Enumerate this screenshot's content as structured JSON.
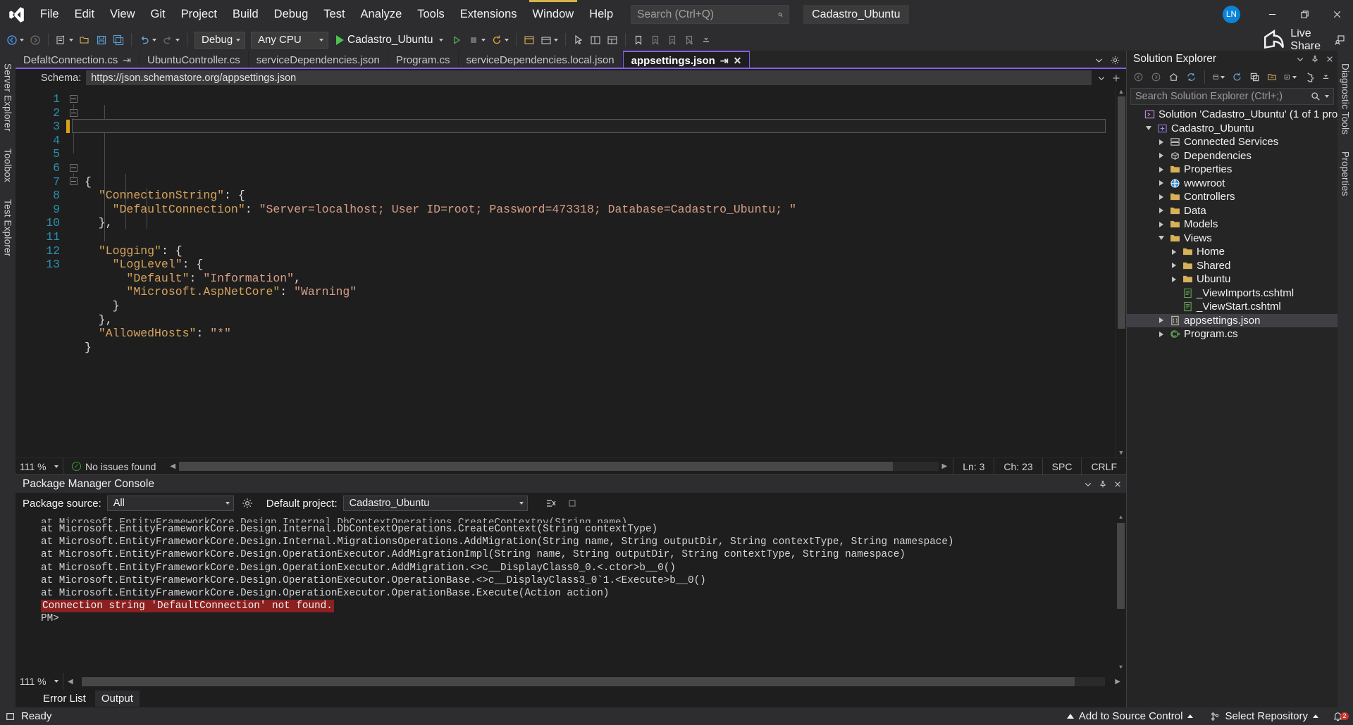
{
  "titlebar": {
    "logo_icon": "visual-studio-logo",
    "menus": [
      "File",
      "Edit",
      "View",
      "Git",
      "Project",
      "Build",
      "Debug",
      "Test",
      "Analyze",
      "Tools",
      "Extensions",
      "Window",
      "Help"
    ],
    "search_placeholder": "Search (Ctrl+Q)",
    "search_value": "",
    "search_icon": "search-icon",
    "project_chip": "Cadastro_Ubuntu",
    "avatar_initials": "LN",
    "minimize_icon": "minimize-icon",
    "restore_icon": "restore-icon",
    "close_icon": "close-icon"
  },
  "toolbar": {
    "config": "Debug",
    "platform": "Any CPU",
    "run_target": "Cadastro_Ubuntu",
    "live_share": "Live Share",
    "icons": [
      "back-icon",
      "forward-icon",
      "new-project-icon",
      "open-project-icon",
      "save-icon",
      "save-all-icon",
      "undo-icon",
      "redo-icon",
      "start-debug-icon",
      "start-without-debug-icon",
      "stop-icon",
      "restart-icon",
      "window-layout-icon",
      "toolbox-icon",
      "select-element-icon",
      "properties-icon",
      "bookmark-icon",
      "prev-bookmark-icon",
      "next-bookmark-icon",
      "clear-bookmarks-icon",
      "overflow-icon",
      "live-share-icon",
      "share-session-icon"
    ]
  },
  "left_rail": [
    "Server Explorer",
    "Toolbox",
    "Test Explorer"
  ],
  "right_rail": [
    "Diagnostic Tools",
    "Properties"
  ],
  "tabs": [
    {
      "label": "DefaltConnection.cs",
      "pinned": true,
      "active": false
    },
    {
      "label": "UbuntuController.cs",
      "pinned": false,
      "active": false
    },
    {
      "label": "serviceDependencies.json",
      "pinned": false,
      "active": false
    },
    {
      "label": "Program.cs",
      "pinned": false,
      "active": false
    },
    {
      "label": "serviceDependencies.local.json",
      "pinned": false,
      "active": false
    },
    {
      "label": "appsettings.json",
      "pinned": true,
      "active": true
    }
  ],
  "tabstrip_icons": [
    "tab-list-dropdown-icon",
    "editor-settings-icon"
  ],
  "schema_bar": {
    "label": "Schema:",
    "value": "https://json.schemastore.org/appsettings.json",
    "dropdown_icon": "chevron-down-icon",
    "split_icon": "split-view-icon"
  },
  "editor": {
    "lines": [
      {
        "n": 1,
        "tokens": [
          {
            "t": "p",
            "v": "{"
          }
        ]
      },
      {
        "n": 2,
        "tokens": [
          {
            "t": "p",
            "v": "  "
          },
          {
            "t": "k",
            "v": "\"ConnectionString\""
          },
          {
            "t": "p",
            "v": ": {"
          }
        ]
      },
      {
        "n": 3,
        "tokens": [
          {
            "t": "p",
            "v": "    "
          },
          {
            "t": "k",
            "v": "\"DefaultConnection\""
          },
          {
            "t": "p",
            "v": ": "
          },
          {
            "t": "s",
            "v": "\"Server=localhost; User ID=root; Password=473318; Database=Cadastro_Ubuntu; \""
          }
        ]
      },
      {
        "n": 4,
        "tokens": [
          {
            "t": "p",
            "v": "  },"
          }
        ]
      },
      {
        "n": 5,
        "tokens": [
          {
            "t": "p",
            "v": ""
          }
        ]
      },
      {
        "n": 6,
        "tokens": [
          {
            "t": "p",
            "v": "  "
          },
          {
            "t": "k",
            "v": "\"Logging\""
          },
          {
            "t": "p",
            "v": ": {"
          }
        ]
      },
      {
        "n": 7,
        "tokens": [
          {
            "t": "p",
            "v": "    "
          },
          {
            "t": "k",
            "v": "\"LogLevel\""
          },
          {
            "t": "p",
            "v": ": {"
          }
        ]
      },
      {
        "n": 8,
        "tokens": [
          {
            "t": "p",
            "v": "      "
          },
          {
            "t": "k",
            "v": "\"Default\""
          },
          {
            "t": "p",
            "v": ": "
          },
          {
            "t": "s",
            "v": "\"Information\""
          },
          {
            "t": "p",
            "v": ","
          }
        ]
      },
      {
        "n": 9,
        "tokens": [
          {
            "t": "p",
            "v": "      "
          },
          {
            "t": "k",
            "v": "\"Microsoft.AspNetCore\""
          },
          {
            "t": "p",
            "v": ": "
          },
          {
            "t": "s",
            "v": "\"Warning\""
          }
        ]
      },
      {
        "n": 10,
        "tokens": [
          {
            "t": "p",
            "v": "    }"
          }
        ]
      },
      {
        "n": 11,
        "tokens": [
          {
            "t": "p",
            "v": "  },"
          }
        ]
      },
      {
        "n": 12,
        "tokens": [
          {
            "t": "p",
            "v": "  "
          },
          {
            "t": "k",
            "v": "\"AllowedHosts\""
          },
          {
            "t": "p",
            "v": ": "
          },
          {
            "t": "s",
            "v": "\"*\""
          }
        ]
      },
      {
        "n": 13,
        "tokens": [
          {
            "t": "p",
            "v": "}"
          }
        ]
      }
    ]
  },
  "editor_status": {
    "zoom": "111 %",
    "issues": "No issues found",
    "line": "Ln: 3",
    "col": "Ch: 23",
    "spaces": "SPC",
    "eol": "CRLF"
  },
  "solution_explorer": {
    "title": "Solution Explorer",
    "search_placeholder": "Search Solution Explorer (Ctrl+;)",
    "search_value": "",
    "head_icons": [
      "chevron-down-icon",
      "pin-icon",
      "close-icon"
    ],
    "toolbar_icons": [
      "back-icon",
      "forward-icon",
      "home-icon",
      "sync-with-active-doc-icon",
      "view-selector-icon",
      "refresh-icon",
      "collapse-all-icon",
      "show-all-files-icon",
      "preview-selected-icon",
      "properties-icon",
      "overflow-icon"
    ],
    "tree": [
      {
        "depth": 0,
        "label": "Solution 'Cadastro_Ubuntu' (1 of 1 project)",
        "icon": "solution-icon",
        "twisty": "none",
        "selected": false
      },
      {
        "depth": 1,
        "label": "Cadastro_Ubuntu",
        "icon": "project-icon",
        "twisty": "expanded",
        "selected": false
      },
      {
        "depth": 2,
        "label": "Connected Services",
        "icon": "services-icon",
        "twisty": "collapsed",
        "selected": false
      },
      {
        "depth": 2,
        "label": "Dependencies",
        "icon": "deps-icon",
        "twisty": "collapsed",
        "selected": false
      },
      {
        "depth": 2,
        "label": "Properties",
        "icon": "folder-icon",
        "twisty": "collapsed",
        "selected": false
      },
      {
        "depth": 2,
        "label": "wwwroot",
        "icon": "globe-icon",
        "twisty": "collapsed",
        "selected": false
      },
      {
        "depth": 2,
        "label": "Controllers",
        "icon": "folder-icon",
        "twisty": "collapsed",
        "selected": false
      },
      {
        "depth": 2,
        "label": "Data",
        "icon": "folder-icon",
        "twisty": "collapsed",
        "selected": false
      },
      {
        "depth": 2,
        "label": "Models",
        "icon": "folder-icon",
        "twisty": "collapsed",
        "selected": false
      },
      {
        "depth": 2,
        "label": "Views",
        "icon": "folder-icon",
        "twisty": "expanded",
        "selected": false
      },
      {
        "depth": 3,
        "label": "Home",
        "icon": "folder-icon",
        "twisty": "collapsed",
        "selected": false
      },
      {
        "depth": 3,
        "label": "Shared",
        "icon": "folder-icon",
        "twisty": "collapsed",
        "selected": false
      },
      {
        "depth": 3,
        "label": "Ubuntu",
        "icon": "folder-icon",
        "twisty": "collapsed",
        "selected": false
      },
      {
        "depth": 3,
        "label": "_ViewImports.cshtml",
        "icon": "cshtml-icon",
        "twisty": "none",
        "selected": false
      },
      {
        "depth": 3,
        "label": "_ViewStart.cshtml",
        "icon": "cshtml-icon",
        "twisty": "none",
        "selected": false
      },
      {
        "depth": 2,
        "label": "appsettings.json",
        "icon": "json-icon",
        "twisty": "collapsed",
        "selected": true
      },
      {
        "depth": 2,
        "label": "Program.cs",
        "icon": "csharp-icon",
        "twisty": "collapsed",
        "selected": false
      }
    ]
  },
  "package_manager_console": {
    "title": "Package Manager Console",
    "head_icons": [
      "chevron-down-icon",
      "pin-icon",
      "close-icon"
    ],
    "package_source_label": "Package source:",
    "package_source_value": "All",
    "settings_icon": "gear-icon",
    "default_project_label": "Default project:",
    "default_project_value": "Cadastro_Ubuntu",
    "clear_icon": "clear-console-icon",
    "stop_icon": "stop-icon",
    "output_lines": [
      {
        "text": "at Microsoft.EntityFrameworkCore.Design.Internal.DbContextOperations.CreateContextpy(String name)",
        "error": false,
        "clipped": true
      },
      {
        "text": "at Microsoft.EntityFrameworkCore.Design.Internal.DbContextOperations.CreateContext(String contextType)",
        "error": false
      },
      {
        "text": "at Microsoft.EntityFrameworkCore.Design.Internal.MigrationsOperations.AddMigration(String name, String outputDir, String contextType, String namespace)",
        "error": false
      },
      {
        "text": "at Microsoft.EntityFrameworkCore.Design.OperationExecutor.AddMigrationImpl(String name, String outputDir, String contextType, String namespace)",
        "error": false
      },
      {
        "text": "at Microsoft.EntityFrameworkCore.Design.OperationExecutor.AddMigration.<>c__DisplayClass0_0.<.ctor>b__0()",
        "error": false
      },
      {
        "text": "at Microsoft.EntityFrameworkCore.Design.OperationExecutor.OperationBase.<>c__DisplayClass3_0`1.<Execute>b__0()",
        "error": false
      },
      {
        "text": "at Microsoft.EntityFrameworkCore.Design.OperationExecutor.OperationBase.Execute(Action action)",
        "error": false
      },
      {
        "text": "Connection string 'DefaultConnection' not found.",
        "error": true
      },
      {
        "text": "PM>",
        "error": false
      }
    ],
    "zoom": "111 %"
  },
  "bottom_tabs": [
    {
      "label": "Error List",
      "active": false
    },
    {
      "label": "Output",
      "active": true
    }
  ],
  "statusbar": {
    "ready": "Ready",
    "ready_icon": "ready-icon",
    "add_to_source_control": "Add to Source Control",
    "select_repository": "Select Repository",
    "repo_icon": "repository-icon",
    "notification_count": "2",
    "notification_icon": "bell-icon"
  },
  "colors": {
    "accent_purple": "#8b5cf6",
    "chrome": "#2d2d30",
    "editor_bg": "#1e1e1e",
    "panel_bg": "#252526",
    "error_red": "#8b2020",
    "gutter_blue": "#2b91af",
    "string_orange": "#d69d85",
    "key_gold": "#d7a35c",
    "avatar_blue": "#0a84d8",
    "badge_red": "#c8322a"
  }
}
